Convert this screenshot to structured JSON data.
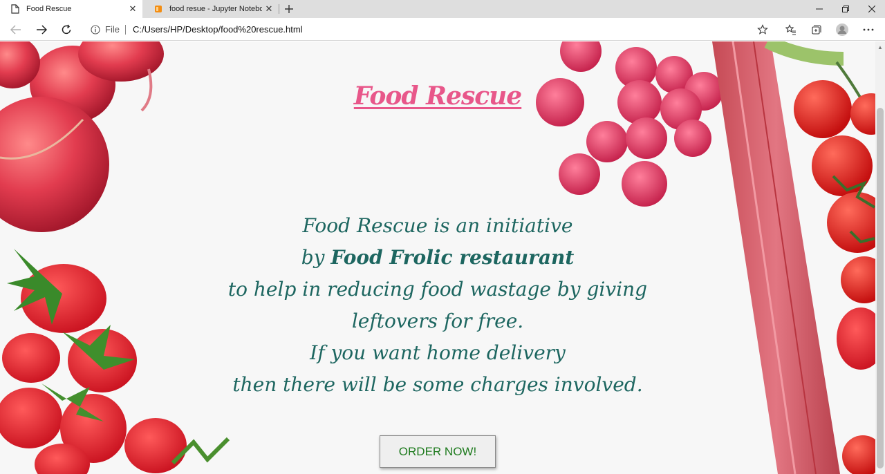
{
  "browser": {
    "tabs": [
      {
        "title": "Food Rescue",
        "active": true,
        "icon": "page-icon"
      },
      {
        "title": "food resue - Jupyter Notebook",
        "active": false,
        "icon": "notebook-icon"
      }
    ],
    "address": {
      "scheme": "File",
      "url": "C:/Users/HP/Desktop/food%20rescue.html"
    }
  },
  "page": {
    "title": "Food Rescue",
    "intro": {
      "line1": "Food Rescue is an initiative",
      "line2_prefix": "by ",
      "line2_bold": "Food Frolic restaurant",
      "line3": "to help in reducing food wastage by giving",
      "line4": "leftovers for free.",
      "line5": "If you want home delivery",
      "line6": "then there will be some charges involved."
    },
    "order_button": "ORDER NOW!"
  },
  "colors": {
    "title": "#e8578a",
    "body_text": "#1d6660",
    "button_text": "#1d7a1d"
  }
}
